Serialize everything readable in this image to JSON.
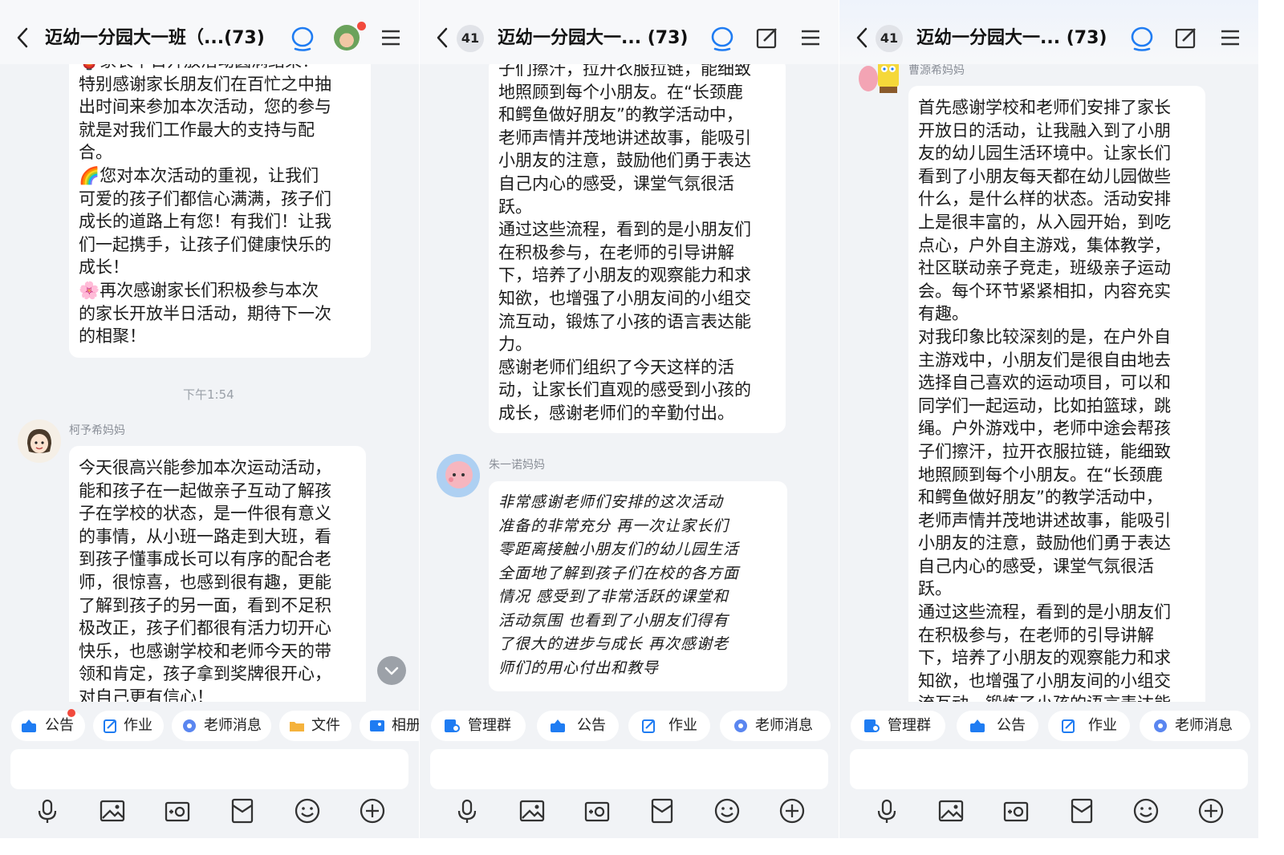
{
  "panels": [
    {
      "title": "迈幼一分园大一班（...(73)",
      "messages_top": {
        "lines": [
          "🏮家长半日开放活动圆满结束！",
          "特别感谢家长朋友们在百忙之中抽",
          "出时间来参加本次活动，您的参与",
          "就是对我们工作最大的支持与配",
          "合。",
          "🌈您对本次活动的重视，让我们",
          "可爱的孩子们都信心满满，孩子们",
          "成长的道路上有您！有我们！让我",
          "们一起携手，让孩子们健康快乐的",
          "成长！",
          "🌸再次感谢家长们积极参与本次",
          "的家长开放半日活动，期待下一次",
          "的相聚！"
        ]
      },
      "time": "下午1:54",
      "sender": "柯予希妈妈",
      "message2": {
        "lines": [
          "今天很高兴能参加本次运动活动，",
          "能和孩子在一起做亲子互动了解孩",
          "子在学校的状态，是一件很有意义",
          "的事情，从小班一路走到大班，看",
          "到孩子懂事成长可以有序的配合老",
          "师，很惊喜，也感到很有趣，更能",
          "了解到孩子的另一面，看到不足积",
          "极改正，孩子们都很有活力切开心",
          "快乐，也感谢学校和老师今天的带",
          "领和肯定，孩子拿到奖牌很开心，",
          "对自己更有信心！"
        ]
      },
      "chips": [
        "公告",
        "作业",
        "老师消息",
        "文件",
        "相册"
      ]
    },
    {
      "badge": "41",
      "title": "迈幼一分园大一... (73)",
      "message1": {
        "lines": [
          "子们擦汗，拉开衣服拉链，能细致",
          "地照顾到每个小朋友。在“长颈鹿",
          "和鳄鱼做好朋友”的教学活动中，",
          "老师声情并茂地讲述故事，能吸引",
          "小朋友的注意，鼓励他们勇于表达",
          "自己内心的感受，课堂气氛很活",
          "跃。",
          "通过这些流程，看到的是小朋友们",
          "在积极参与，在老师的引导讲解",
          "下，培养了小朋友的观察能力和求",
          "知欲，也增强了小朋友间的小组交",
          "流互动，锻炼了小孩的语言表达能",
          "力。",
          "感谢老师们组织了今天这样的活",
          "动，让家长们直观的感受到小孩的",
          "成长，感谢老师们的辛勤付出。"
        ]
      },
      "sender": "朱一诺妈妈",
      "message2": {
        "lines": [
          "非常感谢老师们安排的这次活动",
          "准备的非常充分  再一次让家长们",
          "零距离接触小朋友们的幼儿园生活",
          " 全面地了解到孩子们在校的各方面",
          "情况  感受到了非常活跃的课堂和",
          "活动氛围  也看到了小朋友们得有",
          "了很大的进步与成长  再次感谢老",
          "师们的用心付出和教导"
        ]
      },
      "chips": [
        "管理群",
        "公告",
        "作业",
        "老师消息"
      ]
    },
    {
      "badge": "41",
      "title": "迈幼一分园大一... (73)",
      "sender": "曹源希妈妈",
      "message1": {
        "lines": [
          "首先感谢学校和老师们安排了家长",
          "开放日的活动，让我融入到了小朋",
          "友的幼儿园生活环境中。让家长们",
          "看到了小朋友每天都在幼儿园做些",
          "什么，是什么样的状态。活动安排",
          "上是很丰富的，从入园开始，到吃",
          "点心，户外自主游戏，集体教学，",
          "社区联动亲子竞走，班级亲子运动",
          "会。每个环节紧紧相扣，内容充实",
          "有趣。",
          "对我印象比较深刻的是，在户外自",
          "主游戏中，小朋友们是很自由地去",
          "选择自己喜欢的运动项目，可以和",
          "同学们一起运动，比如拍篮球，跳",
          "绳。户外游戏中，老师中途会帮孩",
          "子们擦汗，拉开衣服拉链，能细致",
          "地照顾到每个小朋友。在“长颈鹿",
          "和鳄鱼做好朋友”的教学活动中，",
          "老师声情并茂地讲述故事，能吸引",
          "小朋友的注意，鼓励他们勇于表达",
          "自己内心的感受，课堂气氛很活",
          "跃。",
          "通过这些流程，看到的是小朋友们",
          "在积极参与，在老师的引导讲解",
          "下，培养了小朋友的观察能力和求",
          "知欲，也增强了小朋友间的小组交",
          "流互动，锻炼了小孩的语言表达能"
        ]
      },
      "chips": [
        "管理群",
        "公告",
        "作业",
        "老师消息"
      ]
    }
  ],
  "colors": {
    "accent": "#1f7cf2",
    "badge_red": "#f24a3d",
    "background": "#f1f3f6",
    "bubble": "#ffffff"
  },
  "icons": [
    "back-arrow-icon",
    "chat-bubble-icon",
    "edit-icon",
    "menu-icon",
    "microphone-icon",
    "image-icon",
    "camera-icon",
    "red-packet-icon",
    "emoji-icon",
    "plus-icon",
    "scroll-down-icon"
  ]
}
